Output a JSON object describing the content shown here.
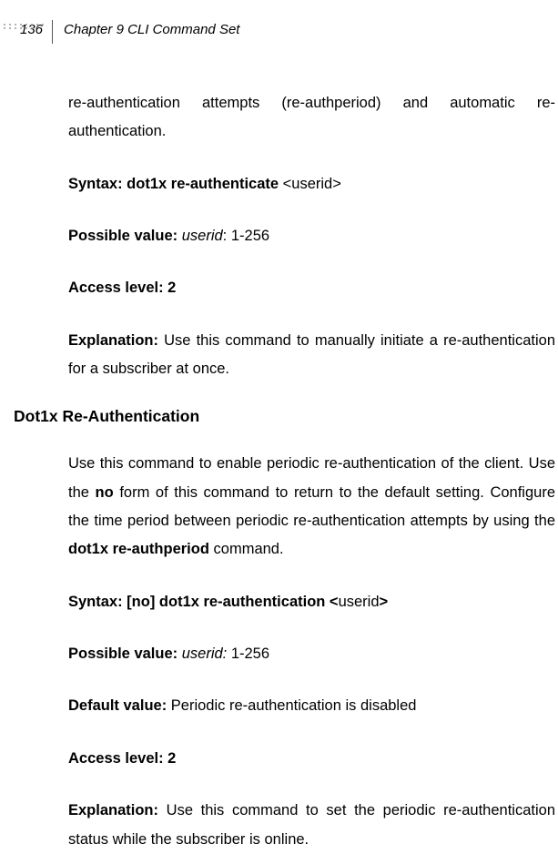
{
  "header": {
    "pageNumber": "136",
    "chapterTitle": "Chapter 9 CLI Command Set"
  },
  "body": {
    "p1": "re-authentication attempts (re-authperiod) and automatic re-authentication.",
    "syntax1_label": "Syntax: dot1x  re-authenticate ",
    "syntax1_arg": " <userid>",
    "possible1_label": "Possible value: ",
    "possible1_var": "userid",
    "possible1_rest": ": 1-256",
    "access1": "Access level: 2",
    "expl1_label": "Explanation:",
    "expl1_text": " Use this command to manually initiate a re-authentication for a subscriber at once.",
    "section_heading": "Dot1x Re-Authentication",
    "p2_a": "Use this command to enable periodic re-authentication of the client. Use the ",
    "p2_no": "no",
    "p2_b": " form of this command to return to the default setting. Configure the time period between periodic re-authentication attempts by using the ",
    "p2_cmd": "dot1x re-authperiod",
    "p2_c": " command.",
    "syntax2_label": "Syntax: [no] dot1x re-authentication <",
    "syntax2_arg": "userid",
    "syntax2_close": ">",
    "possible2_label": "Possible value: ",
    "possible2_var": "userid:",
    "possible2_rest": " 1-256",
    "default_label": "Default value:",
    "default_text": " Periodic re-authentication is disabled",
    "access2": "Access level: 2",
    "expl2_label": "Explanation:",
    "expl2_text": " Use this command to set the periodic re-authentication status while the subscriber is online."
  }
}
